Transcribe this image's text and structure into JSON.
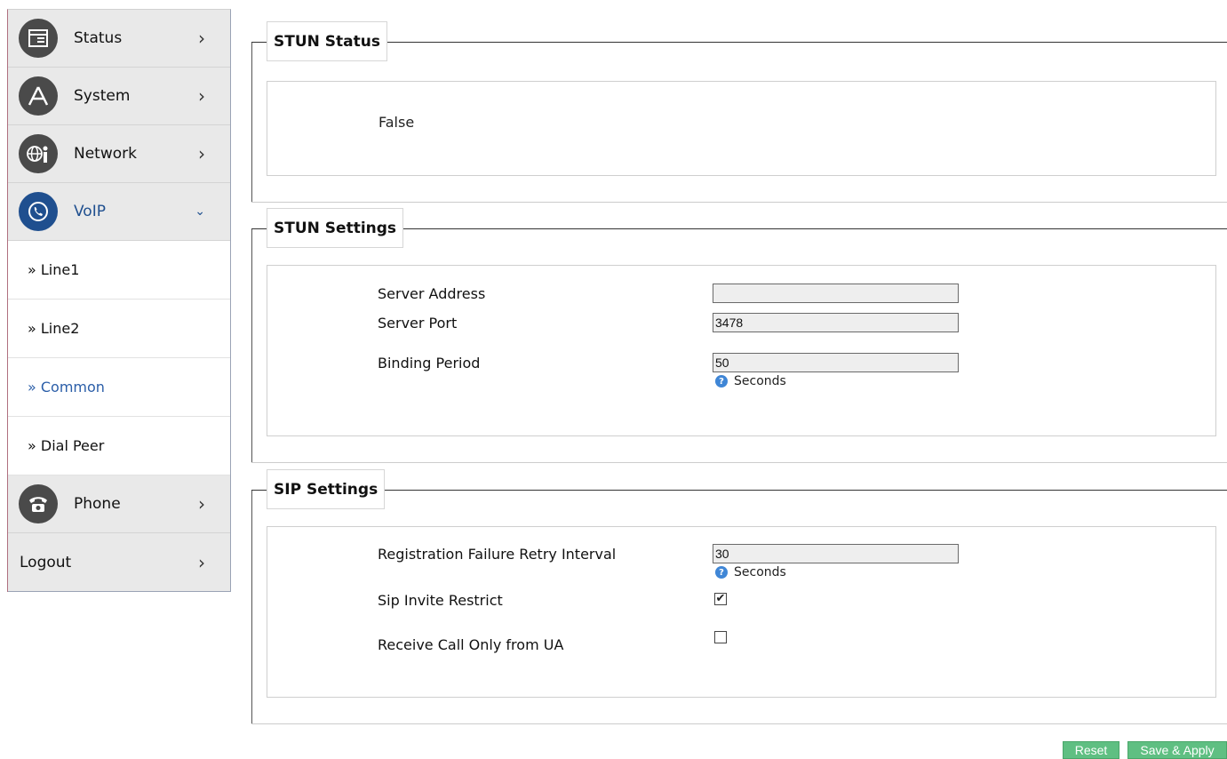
{
  "sidebar": {
    "menu": [
      {
        "label": "Status",
        "icon": "status-icon"
      },
      {
        "label": "System",
        "icon": "system-icon"
      },
      {
        "label": "Network",
        "icon": "network-icon"
      },
      {
        "label": "VoIP",
        "icon": "voip-icon"
      }
    ],
    "sub_items": [
      {
        "label": "» Line1"
      },
      {
        "label": "» Line2"
      },
      {
        "label": "» Common"
      },
      {
        "label": "» Dial Peer"
      }
    ],
    "phone": {
      "label": "Phone",
      "icon": "phone-icon"
    },
    "logout": {
      "label": "Logout"
    }
  },
  "stun_status": {
    "title": "STUN Status",
    "value": "False"
  },
  "stun_settings": {
    "title": "STUN Settings",
    "server_address_label": "Server Address",
    "server_address_value": "",
    "server_port_label": "Server Port",
    "server_port_value": "3478",
    "binding_period_label": "Binding Period",
    "binding_period_value": "50",
    "binding_period_hint": "Seconds"
  },
  "sip_settings": {
    "title": "SIP Settings",
    "retry_label": "Registration Failure Retry Interval",
    "retry_value": "30",
    "retry_hint": "Seconds",
    "invite_restrict_label": "Sip Invite Restrict",
    "invite_restrict_checked": true,
    "receive_ua_label": "Receive Call Only from UA",
    "receive_ua_checked": false
  },
  "buttons": {
    "reset": "Reset",
    "save_apply": "Save & Apply"
  },
  "colors": {
    "accent": "#1f4f8f",
    "button": "#5fbf82"
  }
}
